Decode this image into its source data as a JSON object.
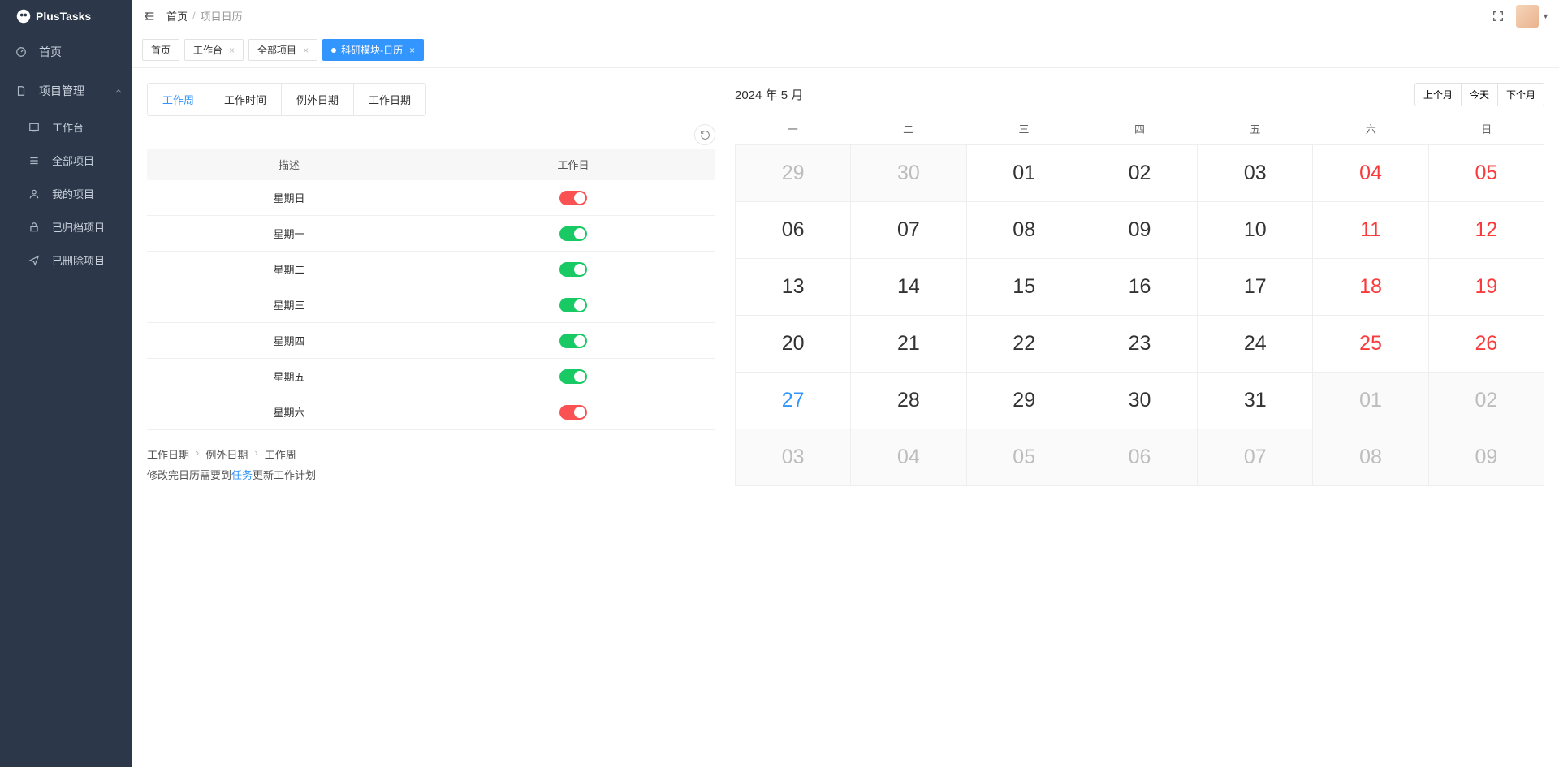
{
  "brand": "PlusTasks",
  "sidebar": {
    "home": "首页",
    "projectMgmt": "项目管理",
    "sub": [
      {
        "icon": "workbench-icon",
        "label": "工作台"
      },
      {
        "icon": "list-icon",
        "label": "全部项目"
      },
      {
        "icon": "user-icon",
        "label": "我的项目"
      },
      {
        "icon": "lock-icon",
        "label": "已归档项目"
      },
      {
        "icon": "send-icon",
        "label": "已删除项目"
      }
    ]
  },
  "breadcrumb": [
    "首页",
    "项目日历"
  ],
  "openTabs": [
    {
      "label": "首页",
      "closable": false,
      "active": false
    },
    {
      "label": "工作台",
      "closable": true,
      "active": false
    },
    {
      "label": "全部项目",
      "closable": true,
      "active": false
    },
    {
      "label": "科研模块-日历",
      "closable": true,
      "active": true,
      "dot": true
    }
  ],
  "innerTabs": [
    {
      "label": "工作周",
      "active": true
    },
    {
      "label": "工作时间",
      "active": false
    },
    {
      "label": "例外日期",
      "active": false
    },
    {
      "label": "工作日期",
      "active": false
    }
  ],
  "weekTable": {
    "headers": [
      "描述",
      "工作日"
    ],
    "rows": [
      {
        "label": "星期日",
        "on": false
      },
      {
        "label": "星期一",
        "on": true
      },
      {
        "label": "星期二",
        "on": true
      },
      {
        "label": "星期三",
        "on": true
      },
      {
        "label": "星期四",
        "on": true
      },
      {
        "label": "星期五",
        "on": true
      },
      {
        "label": "星期六",
        "on": false
      }
    ]
  },
  "footnote": {
    "crumbs": [
      "工作日期",
      "例外日期",
      "工作周"
    ],
    "textBefore": "修改完日历需要到",
    "link": "任务",
    "textAfter": "更新工作计划"
  },
  "calendar": {
    "title": "2024 年 5 月",
    "nav": {
      "prev": "上个月",
      "today": "今天",
      "next": "下个月"
    },
    "weekdays": [
      "一",
      "二",
      "三",
      "四",
      "五",
      "六",
      "日"
    ],
    "cells": [
      {
        "d": "29",
        "other": true
      },
      {
        "d": "30",
        "other": true
      },
      {
        "d": "01"
      },
      {
        "d": "02"
      },
      {
        "d": "03"
      },
      {
        "d": "04",
        "weekend": true
      },
      {
        "d": "05",
        "weekend": true
      },
      {
        "d": "06"
      },
      {
        "d": "07"
      },
      {
        "d": "08"
      },
      {
        "d": "09"
      },
      {
        "d": "10"
      },
      {
        "d": "11",
        "weekend": true
      },
      {
        "d": "12",
        "weekend": true
      },
      {
        "d": "13"
      },
      {
        "d": "14"
      },
      {
        "d": "15"
      },
      {
        "d": "16"
      },
      {
        "d": "17"
      },
      {
        "d": "18",
        "weekend": true
      },
      {
        "d": "19",
        "weekend": true
      },
      {
        "d": "20"
      },
      {
        "d": "21"
      },
      {
        "d": "22"
      },
      {
        "d": "23"
      },
      {
        "d": "24"
      },
      {
        "d": "25",
        "weekend": true
      },
      {
        "d": "26",
        "weekend": true
      },
      {
        "d": "27",
        "today": true
      },
      {
        "d": "28"
      },
      {
        "d": "29"
      },
      {
        "d": "30"
      },
      {
        "d": "31"
      },
      {
        "d": "01",
        "other": true
      },
      {
        "d": "02",
        "other": true
      },
      {
        "d": "03",
        "other": true
      },
      {
        "d": "04",
        "other": true
      },
      {
        "d": "05",
        "other": true
      },
      {
        "d": "06",
        "other": true
      },
      {
        "d": "07",
        "other": true
      },
      {
        "d": "08",
        "other": true
      },
      {
        "d": "09",
        "other": true
      }
    ]
  }
}
